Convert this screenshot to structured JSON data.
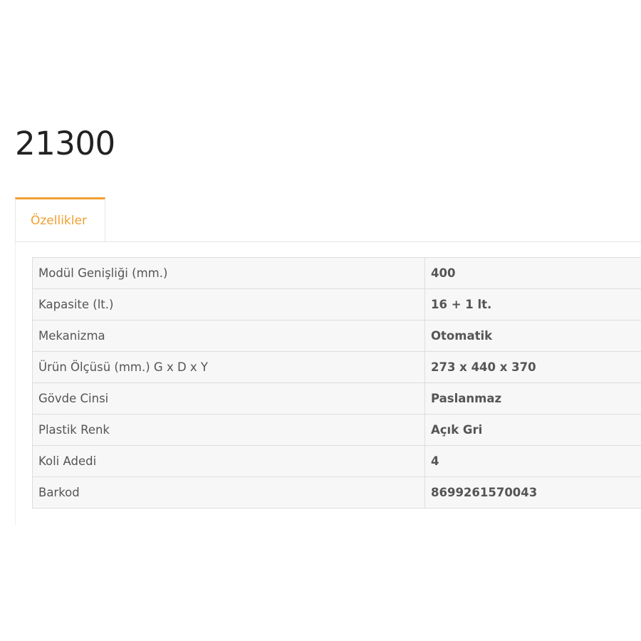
{
  "product": {
    "title": "21300"
  },
  "tabs": [
    {
      "label": "Özellikler",
      "active": true
    }
  ],
  "accent_color": "#f0a030",
  "specs": [
    {
      "label": "Modül Genişliği (mm.)",
      "value": "400"
    },
    {
      "label": "Kapasite (lt.)",
      "value": "16 + 1 lt."
    },
    {
      "label": "Mekanizma",
      "value": "Otomatik"
    },
    {
      "label": "Ürün Ölçüsü (mm.) G x D x Y",
      "value": "273 x 440 x 370"
    },
    {
      "label": "Gövde Cinsi",
      "value": "Paslanmaz"
    },
    {
      "label": "Plastik Renk",
      "value": "Açık Gri"
    },
    {
      "label": "Koli Adedi",
      "value": "4"
    },
    {
      "label": "Barkod",
      "value": "8699261570043"
    }
  ]
}
